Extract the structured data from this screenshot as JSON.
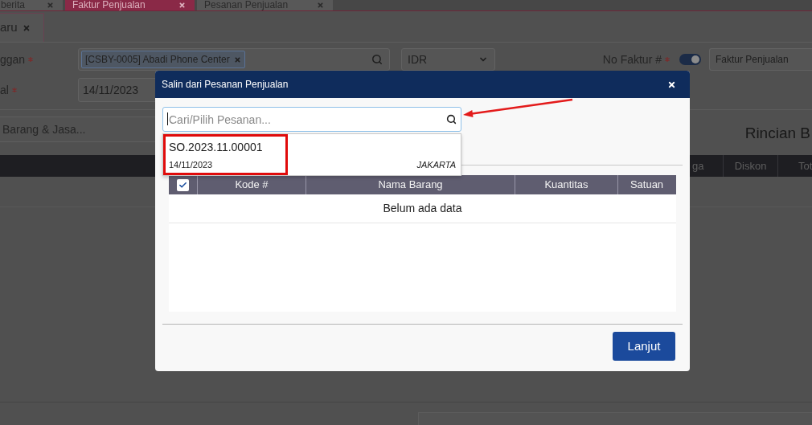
{
  "app_tabs": [
    {
      "label": "berita",
      "selected": false
    },
    {
      "label": "Faktur Penjualan",
      "selected": true
    },
    {
      "label": "Pesanan Penjualan",
      "selected": false
    }
  ],
  "doc_tabs": [
    {
      "label": "aru",
      "selected": true
    }
  ],
  "form": {
    "customer": {
      "label": "ggan",
      "required": true,
      "tag": "[CSBY-0005] Abadi Phone Center"
    },
    "currency": {
      "value": "IDR"
    },
    "invoice_no": {
      "label": "No Faktur #",
      "required": true,
      "auto_number": true,
      "value": "Faktur Penjualan"
    },
    "date": {
      "label": "al",
      "required": true,
      "value": "14/11/2023"
    }
  },
  "item_search": {
    "placeholder": "Barang & Jasa..."
  },
  "details": {
    "title": "Rincian B",
    "columns": [
      "ga",
      "Diskon",
      "Tot"
    ]
  },
  "dialog": {
    "title": "Salin dari Pesanan Penjualan",
    "search": {
      "placeholder": "Cari/Pilih Pesanan..."
    },
    "suggestions": [
      {
        "number": "SO.2023.11.00001",
        "date": "14/11/2023",
        "location": "JAKARTA"
      }
    ],
    "table": {
      "select_all_checked": true,
      "columns": [
        "Kode #",
        "Nama Barang",
        "Kuantitas",
        "Satuan"
      ],
      "empty_text": "Belum ada data"
    },
    "buttons": [
      "Lanjut"
    ]
  }
}
